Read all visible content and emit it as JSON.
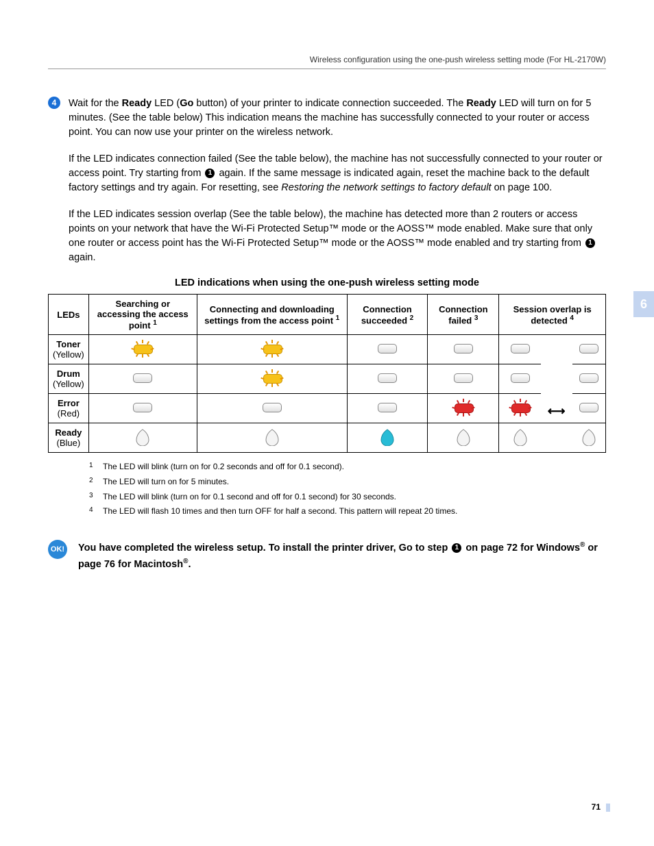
{
  "header": "Wireless configuration using the one-push wireless setting mode (For HL-2170W)",
  "chapter_tab": "6",
  "page_number": "71",
  "step4": {
    "num": "4",
    "text_before_ready": "Wait for the ",
    "ready1": "Ready",
    "text_mid1": " LED (",
    "go": "Go",
    "text_mid2": " button) of your printer to indicate connection succeeded. The ",
    "ready2": "Ready",
    "text_after": " LED will turn on for 5 minutes. (See the table below) This indication means the machine has successfully connected to your router or access point. You can now use your printer on the wireless network."
  },
  "para_failed": {
    "p1": "If the LED indicates connection failed (See the table below), the machine has not successfully connected to your router or access point. Try starting from ",
    "ref1": "1",
    "p2": " again. If the same message is indicated again, reset the machine back to the default factory settings and try again. For resetting, see ",
    "italic": "Restoring the network settings to factory default",
    "p3": " on page 100."
  },
  "para_overlap": {
    "p1": "If the LED indicates session overlap (See the table below), the machine has detected more than 2 routers or access points on your network that have the Wi-Fi Protected Setup™ mode or the AOSS™ mode enabled. Make sure that only one router or access point has the Wi-Fi Protected Setup™ mode or the AOSS™ mode enabled and try starting from ",
    "ref1": "1",
    "p2": " again."
  },
  "table_title": "LED indications when using the one-push wireless setting mode",
  "table": {
    "headers": {
      "leds": "LEDs",
      "col1": "Searching or accessing the access point",
      "col1_sup": "1",
      "col2": "Connecting and downloading settings from the access point",
      "col2_sup": "1",
      "col3": "Connection succeeded",
      "col3_sup": "2",
      "col4": "Connection failed",
      "col4_sup": "3",
      "col5": "Session overlap is detected",
      "col5_sup": "4"
    },
    "rows": [
      {
        "name": "Toner",
        "color": "(Yellow)"
      },
      {
        "name": "Drum",
        "color": "(Yellow)"
      },
      {
        "name": "Error",
        "color": "(Red)"
      },
      {
        "name": "Ready",
        "color": "(Blue)"
      }
    ]
  },
  "footnotes": {
    "f1n": "1",
    "f1": "The LED will blink (turn on for 0.2 seconds and off for 0.1 second).",
    "f2n": "2",
    "f2": "The LED will turn on for 5 minutes.",
    "f3n": "3",
    "f3": "The LED will blink (turn on for 0.1 second and off for 0.1 second) for 30 seconds.",
    "f4n": "4",
    "f4": "The LED will flash 10 times and then turn OFF for half a second. This pattern will repeat 20 times."
  },
  "ok": {
    "label": "OK!",
    "t1": "You have completed the wireless setup. To install the printer driver, Go to step ",
    "ref": "1",
    "t2": " on page 72 for Windows",
    "reg1": "®",
    "t3": " or page 76 for Macintosh",
    "reg2": "®",
    "t4": "."
  },
  "chart_data": {
    "type": "table",
    "title": "LED indications when using the one-push wireless setting mode",
    "columns": [
      "LEDs",
      "Searching or accessing the access point",
      "Connecting and downloading settings from the access point",
      "Connection succeeded",
      "Connection failed",
      "Session overlap is detected (pattern A)",
      "Session overlap arrow",
      "Session overlap is detected (pattern B)"
    ],
    "rows": [
      [
        "Toner (Yellow)",
        "blink-yellow",
        "blink-yellow",
        "off",
        "off",
        "off",
        "",
        "off"
      ],
      [
        "Drum (Yellow)",
        "off",
        "blink-yellow",
        "off",
        "off",
        "off",
        "",
        "off"
      ],
      [
        "Error (Red)",
        "off",
        "off",
        "off",
        "blink-red",
        "blink-red",
        "↔",
        "off"
      ],
      [
        "Ready (Blue)",
        "drop-off",
        "drop-off",
        "drop-on-blue",
        "drop-off",
        "drop-off",
        "",
        "drop-off"
      ]
    ],
    "footnote_map": {
      "Searching or accessing the access point": 1,
      "Connecting and downloading settings from the access point": 1,
      "Connection succeeded": 2,
      "Connection failed": 3,
      "Session overlap is detected": 4
    }
  }
}
